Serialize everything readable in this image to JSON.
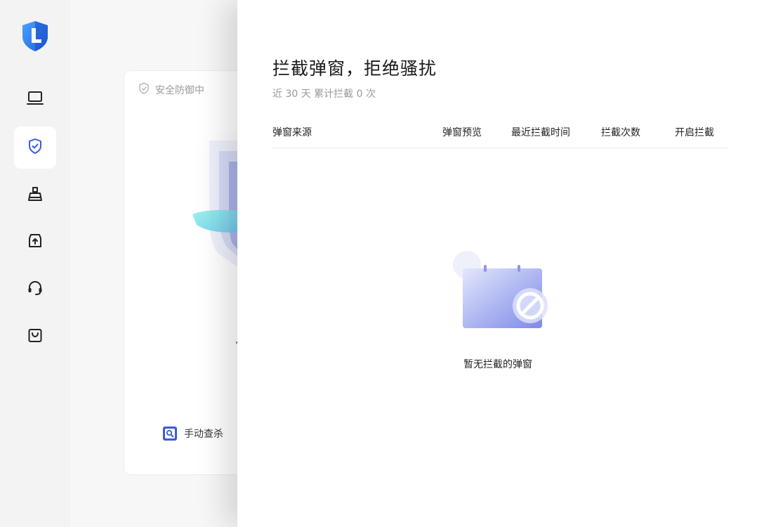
{
  "sidebar": {
    "items": [
      {
        "name": "computer",
        "icon": "laptop-icon"
      },
      {
        "name": "protection",
        "icon": "shield-check-icon",
        "active": true
      },
      {
        "name": "cleanup",
        "icon": "broom-icon"
      },
      {
        "name": "software",
        "icon": "download-box-icon"
      },
      {
        "name": "support",
        "icon": "headset-icon"
      },
      {
        "name": "store",
        "icon": "shopping-bag-icon"
      }
    ]
  },
  "background": {
    "status_text": "安全防御中",
    "manual_scan_label": "手动查杀"
  },
  "drawer": {
    "title": "拦截弹窗，拒绝骚扰",
    "subtitle": "近 30 天 累计拦截 0 次",
    "columns": {
      "source": "弹窗来源",
      "preview": "弹窗预览",
      "last_time": "最近拦截时间",
      "count": "拦截次数",
      "toggle": "开启拦截"
    },
    "empty_text": "暂无拦截的弹窗"
  },
  "colors": {
    "accent": "#3b5bdb",
    "sidebar_bg": "#f3f3f3",
    "brand_blue": "#2f6df6"
  }
}
